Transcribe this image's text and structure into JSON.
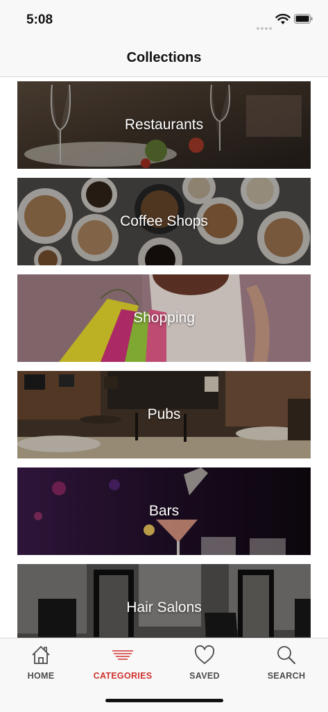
{
  "status_bar": {
    "time": "5:08"
  },
  "nav": {
    "title": "Collections"
  },
  "collections": [
    {
      "label": "Restaurants",
      "image": "restaurant-photo"
    },
    {
      "label": "Coffee Shops",
      "image": "coffee-photo"
    },
    {
      "label": "Shopping",
      "image": "shopping-photo"
    },
    {
      "label": "Pubs",
      "image": "pub-photo"
    },
    {
      "label": "Bars",
      "image": "bar-photo"
    },
    {
      "label": "Hair Salons",
      "image": "salon-photo"
    }
  ],
  "tabs": [
    {
      "label": "HOME",
      "icon": "home-icon",
      "active": false
    },
    {
      "label": "CATEGORIES",
      "icon": "categories-icon",
      "active": true
    },
    {
      "label": "SAVED",
      "icon": "heart-icon",
      "active": false
    },
    {
      "label": "SEARCH",
      "icon": "search-icon",
      "active": false
    }
  ],
  "colors": {
    "accent": "#d0312d",
    "tab_inactive": "#4a4a4a"
  }
}
